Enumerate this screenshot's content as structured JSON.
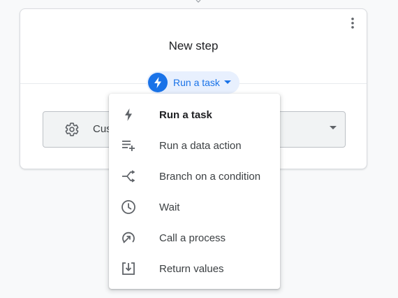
{
  "card": {
    "title": "New step",
    "step_type_chip": {
      "label": "Run a task",
      "icon": "bolt-icon",
      "accent": "#1a73e8",
      "background": "#e8f0fe"
    },
    "select": {
      "value": "Cus",
      "icon": "gear-icon"
    },
    "more_icon": "more-vert-icon"
  },
  "menu": {
    "items": [
      {
        "label": "Run a task",
        "icon": "bolt-icon",
        "selected": true
      },
      {
        "label": "Run a data action",
        "icon": "playlist-add-icon",
        "selected": false
      },
      {
        "label": "Branch on a condition",
        "icon": "branch-icon",
        "selected": false
      },
      {
        "label": "Wait",
        "icon": "clock-icon",
        "selected": false
      },
      {
        "label": "Call a process",
        "icon": "call-process-icon",
        "selected": false
      },
      {
        "label": "Return values",
        "icon": "return-values-icon",
        "selected": false
      }
    ]
  },
  "colors": {
    "text": "#3c4043",
    "icon": "#5f6368",
    "accent": "#1a73e8"
  }
}
